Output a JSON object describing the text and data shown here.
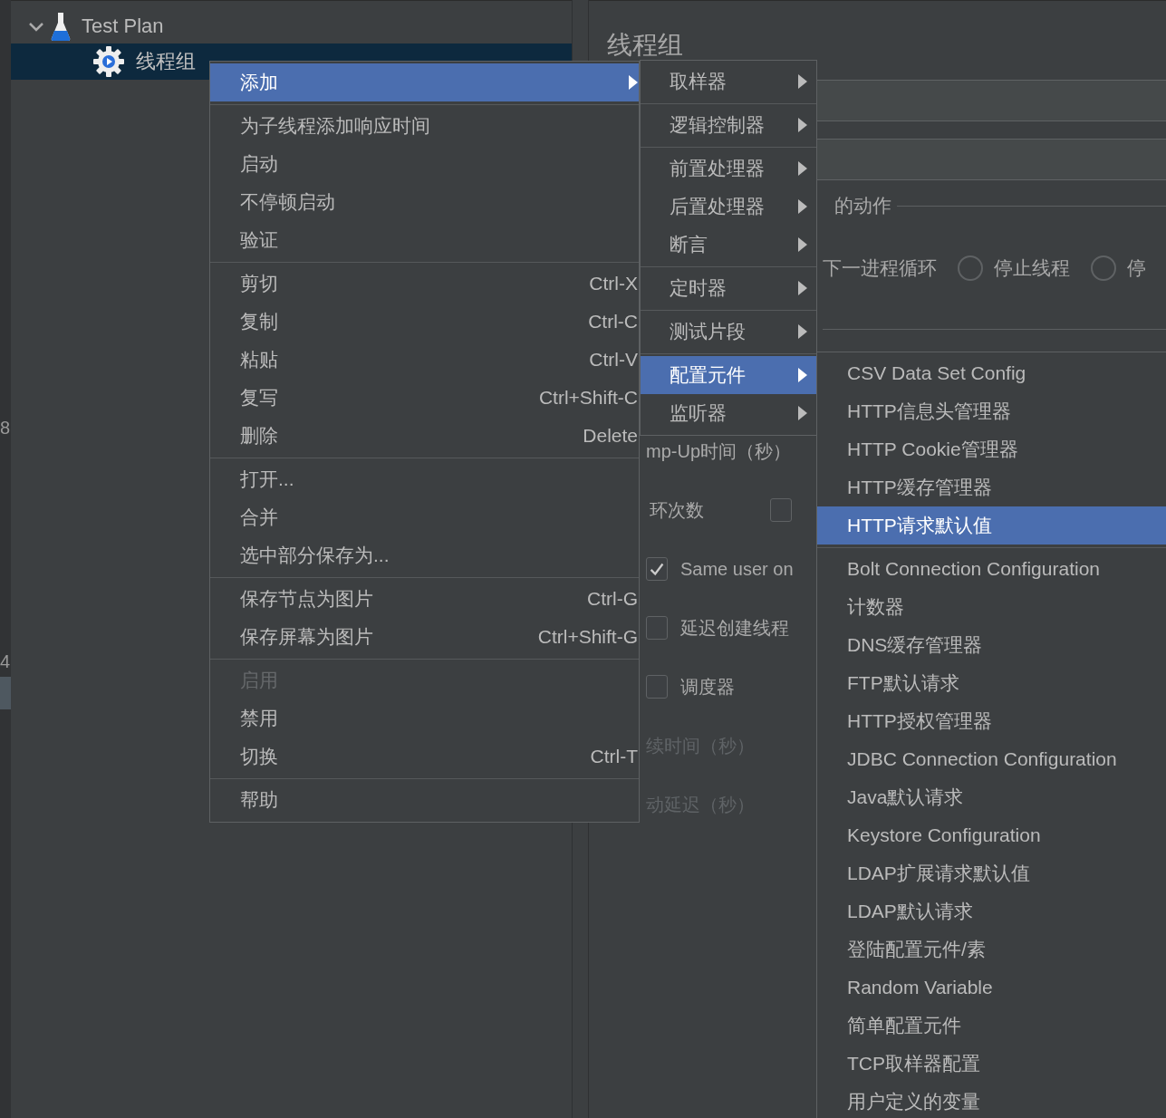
{
  "left_edge": {
    "labels": [
      "8",
      "4"
    ]
  },
  "tree": [
    {
      "label": "Test Plan",
      "kind": "flask",
      "expanded": true,
      "selected": false,
      "children": [
        {
          "label": "线程组",
          "kind": "gear",
          "selected": true
        }
      ]
    }
  ],
  "panel": {
    "title": "线程组",
    "section_label": "的动作",
    "on_error_options": [
      {
        "kind": "text",
        "label": "下一进程循环"
      },
      {
        "kind": "radio",
        "label": "停止线程",
        "selected": false
      },
      {
        "kind": "radio",
        "label": "停",
        "selected": false
      }
    ],
    "settings": [
      {
        "kind": "text",
        "label": "mp-Up时间（秒）",
        "disabled": false
      },
      {
        "kind": "checkbox_after",
        "label": "环次数",
        "checked": false,
        "disabled": false
      },
      {
        "kind": "checkbox",
        "label": "Same user on",
        "checked": true,
        "disabled": false
      },
      {
        "kind": "checkbox",
        "label": "延迟创建线程",
        "checked": false,
        "disabled": false
      },
      {
        "kind": "checkbox",
        "label": "调度器",
        "checked": false,
        "disabled": false
      },
      {
        "kind": "text",
        "label": "续时间（秒）",
        "disabled": true
      },
      {
        "kind": "text",
        "label": "动延迟（秒）",
        "disabled": true
      }
    ]
  },
  "context_menu": {
    "groups": [
      [
        {
          "label": "添加",
          "kind": "submenu",
          "selected": true,
          "disabled": false
        }
      ],
      [
        {
          "label": "为子线程添加响应时间",
          "kind": "command",
          "selected": false,
          "disabled": false
        },
        {
          "label": "启动",
          "kind": "command",
          "selected": false,
          "disabled": false
        },
        {
          "label": "不停顿启动",
          "kind": "command",
          "selected": false,
          "disabled": false
        },
        {
          "label": "验证",
          "kind": "command",
          "selected": false,
          "disabled": false
        }
      ],
      [
        {
          "label": "剪切",
          "shortcut": "Ctrl-X",
          "kind": "command",
          "selected": false,
          "disabled": false
        },
        {
          "label": "复制",
          "shortcut": "Ctrl-C",
          "kind": "command",
          "selected": false,
          "disabled": false
        },
        {
          "label": "粘贴",
          "shortcut": "Ctrl-V",
          "kind": "command",
          "selected": false,
          "disabled": false
        },
        {
          "label": "复写",
          "shortcut": "Ctrl+Shift-C",
          "kind": "command",
          "selected": false,
          "disabled": false
        },
        {
          "label": "删除",
          "shortcut": "Delete",
          "kind": "command",
          "selected": false,
          "disabled": false
        }
      ],
      [
        {
          "label": "打开...",
          "kind": "command",
          "selected": false,
          "disabled": false
        },
        {
          "label": "合并",
          "kind": "command",
          "selected": false,
          "disabled": false
        },
        {
          "label": "选中部分保存为...",
          "kind": "command",
          "selected": false,
          "disabled": false
        }
      ],
      [
        {
          "label": "保存节点为图片",
          "shortcut": "Ctrl-G",
          "kind": "command",
          "selected": false,
          "disabled": false
        },
        {
          "label": "保存屏幕为图片",
          "shortcut": "Ctrl+Shift-G",
          "kind": "command",
          "selected": false,
          "disabled": false
        }
      ],
      [
        {
          "label": "启用",
          "kind": "command",
          "selected": false,
          "disabled": true
        },
        {
          "label": "禁用",
          "kind": "command",
          "selected": false,
          "disabled": false
        },
        {
          "label": "切换",
          "shortcut": "Ctrl-T",
          "kind": "command",
          "selected": false,
          "disabled": false
        }
      ],
      [
        {
          "label": "帮助",
          "kind": "command",
          "selected": false,
          "disabled": false
        }
      ]
    ]
  },
  "add_submenu": {
    "groups": [
      [
        {
          "label": "取样器",
          "kind": "submenu",
          "selected": false
        }
      ],
      [
        {
          "label": "逻辑控制器",
          "kind": "submenu",
          "selected": false
        }
      ],
      [
        {
          "label": "前置处理器",
          "kind": "submenu",
          "selected": false
        },
        {
          "label": "后置处理器",
          "kind": "submenu",
          "selected": false
        },
        {
          "label": "断言",
          "kind": "submenu",
          "selected": false
        }
      ],
      [
        {
          "label": "定时器",
          "kind": "submenu",
          "selected": false
        }
      ],
      [
        {
          "label": "测试片段",
          "kind": "submenu",
          "selected": false
        }
      ],
      [
        {
          "label": "配置元件",
          "kind": "submenu",
          "selected": true
        },
        {
          "label": "监听器",
          "kind": "submenu",
          "selected": false
        }
      ]
    ]
  },
  "config_submenu": {
    "groups": [
      [
        {
          "label": "CSV Data Set Config",
          "selected": false
        },
        {
          "label": "HTTP信息头管理器",
          "selected": false
        },
        {
          "label": "HTTP Cookie管理器",
          "selected": false
        },
        {
          "label": "HTTP缓存管理器",
          "selected": false
        },
        {
          "label": "HTTP请求默认值",
          "selected": true
        }
      ],
      [
        {
          "label": "Bolt Connection Configuration",
          "selected": false
        },
        {
          "label": "计数器",
          "selected": false
        },
        {
          "label": "DNS缓存管理器",
          "selected": false
        },
        {
          "label": "FTP默认请求",
          "selected": false
        },
        {
          "label": "HTTP授权管理器",
          "selected": false
        },
        {
          "label": "JDBC Connection Configuration",
          "selected": false
        },
        {
          "label": "Java默认请求",
          "selected": false
        },
        {
          "label": "Keystore Configuration",
          "selected": false
        },
        {
          "label": "LDAP扩展请求默认值",
          "selected": false
        },
        {
          "label": "LDAP默认请求",
          "selected": false
        },
        {
          "label": "登陆配置元件/素",
          "selected": false
        },
        {
          "label": "Random Variable",
          "selected": false
        },
        {
          "label": "简单配置元件",
          "selected": false
        },
        {
          "label": "TCP取样器配置",
          "selected": false
        },
        {
          "label": "用户定义的变量",
          "selected": false
        }
      ]
    ]
  }
}
